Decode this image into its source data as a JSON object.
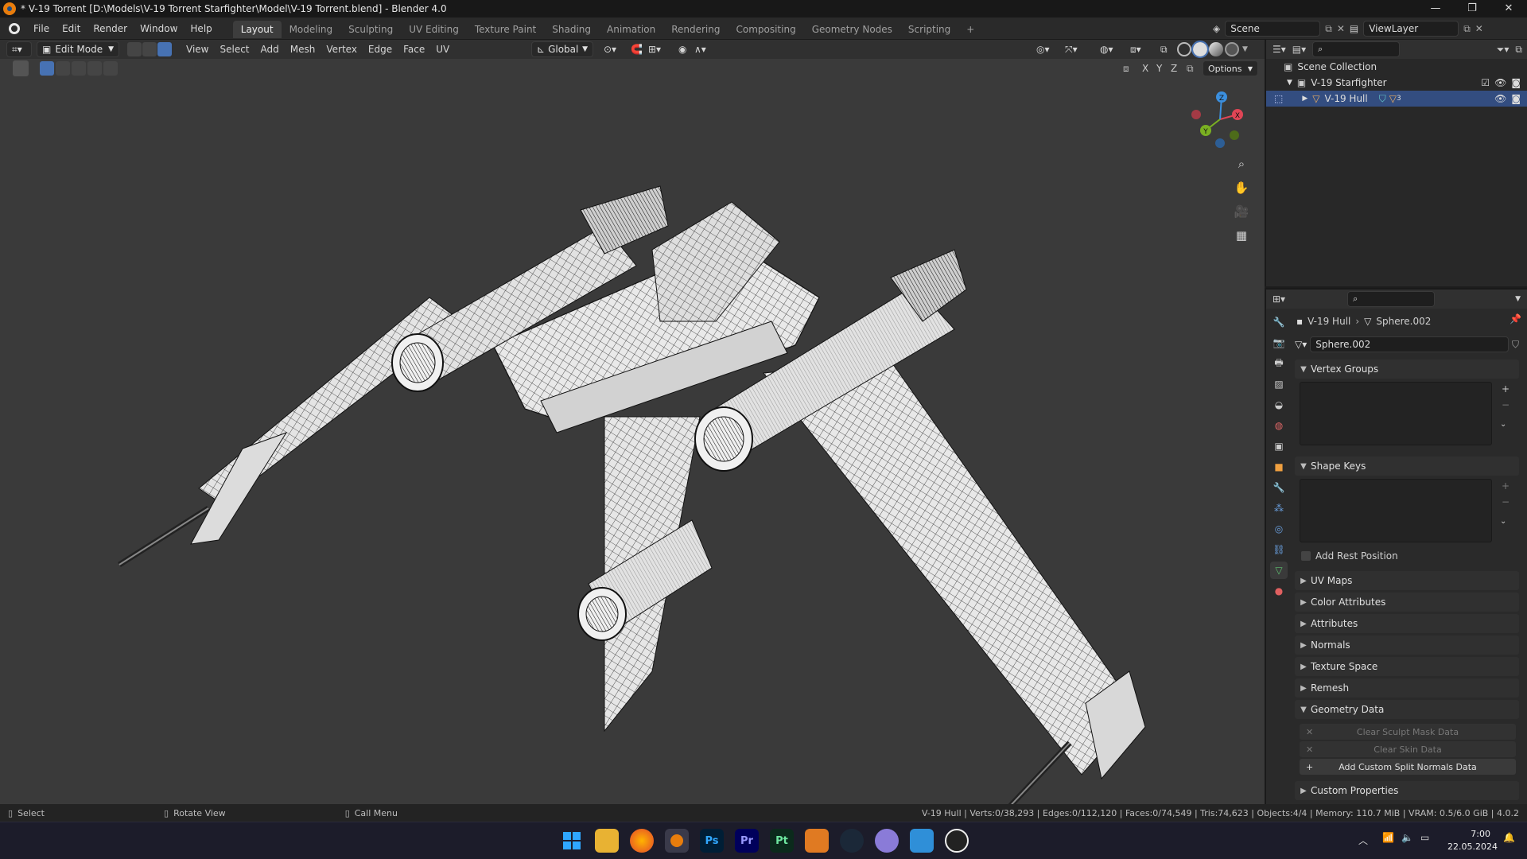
{
  "window": {
    "title": "* V-19 Torrent [D:\\Models\\V-19 Torrent Starfighter\\Model\\V-19 Torrent.blend] - Blender 4.0"
  },
  "menu": {
    "items": [
      "File",
      "Edit",
      "Render",
      "Window",
      "Help"
    ]
  },
  "workspaces": {
    "tabs": [
      "Layout",
      "Modeling",
      "Sculpting",
      "UV Editing",
      "Texture Paint",
      "Shading",
      "Animation",
      "Rendering",
      "Compositing",
      "Geometry Nodes",
      "Scripting"
    ],
    "active": "Layout",
    "add_label": "+"
  },
  "scene": {
    "name": "Scene",
    "viewlayer": "ViewLayer"
  },
  "viewport_header": {
    "mode": "Edit Mode",
    "menus": [
      "View",
      "Select",
      "Add",
      "Mesh",
      "Vertex",
      "Edge",
      "Face",
      "UV"
    ],
    "orientation": "Global",
    "options_label": "Options",
    "axes": [
      "X",
      "Y",
      "Z"
    ]
  },
  "gizmo": {
    "x": "X",
    "y": "Y",
    "z": "Z"
  },
  "outliner": {
    "root": "Scene Collection",
    "collection": "V-19 Starfighter",
    "object": "V-19 Hull",
    "modifier_count": "3"
  },
  "properties": {
    "breadcrumb_object": "V-19 Hull",
    "breadcrumb_data": "Sphere.002",
    "datablock_name": "Sphere.002",
    "panels": {
      "vertex_groups": "Vertex Groups",
      "shape_keys": "Shape Keys",
      "add_rest_position": "Add Rest Position",
      "uv_maps": "UV Maps",
      "color_attributes": "Color Attributes",
      "attributes": "Attributes",
      "normals": "Normals",
      "texture_space": "Texture Space",
      "remesh": "Remesh",
      "geometry_data": "Geometry Data",
      "custom_properties": "Custom Properties"
    },
    "geometry_buttons": {
      "clear_sculpt": "Clear Sculpt Mask Data",
      "clear_skin": "Clear Skin Data",
      "add_split_normals": "Add Custom Split Normals Data"
    }
  },
  "statusbar": {
    "select": "Select",
    "rotate": "Rotate View",
    "call_menu": "Call Menu",
    "stats": "V-19 Hull | Verts:0/38,293 | Edges:0/112,120 | Faces:0/74,549 | Tris:74,623 | Objects:4/4 | Memory: 110.7 MiB | VRAM: 0.5/6.0 GiB | 4.0.2"
  },
  "taskbar": {
    "time": "7:00",
    "date": "22.05.2024",
    "apps": [
      "Ps",
      "Pr",
      "Pt"
    ]
  },
  "colors": {
    "accent": "#4772b3",
    "viewport_bg": "#3a3a3a",
    "wire": "#000000",
    "mesh": "#e6e6e6"
  }
}
